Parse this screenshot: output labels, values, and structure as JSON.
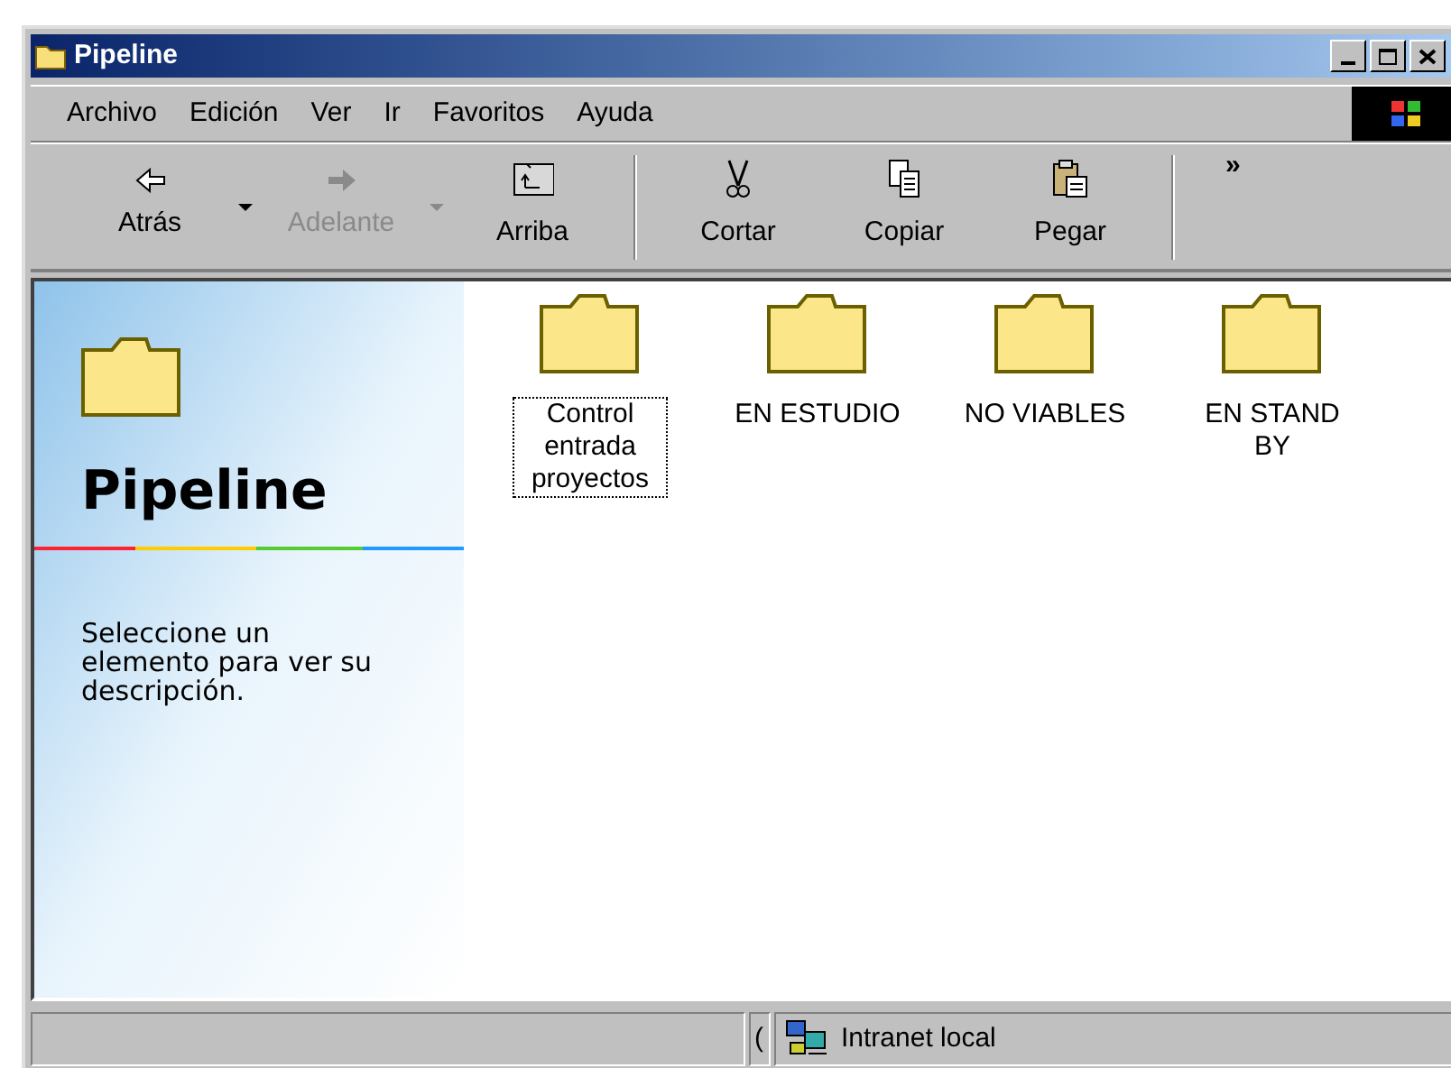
{
  "window": {
    "title": "Pipeline"
  },
  "menu": [
    "Archivo",
    "Edición",
    "Ver",
    "Ir",
    "Favoritos",
    "Ayuda"
  ],
  "toolbar": [
    {
      "kind": "back",
      "label": "Atrás",
      "disabled": false,
      "dropdown": true
    },
    {
      "kind": "forward",
      "label": "Adelante",
      "disabled": true,
      "dropdown": true
    },
    {
      "kind": "up",
      "label": "Arriba",
      "disabled": false,
      "dropdown": false
    },
    {
      "kind": "separator"
    },
    {
      "kind": "cut",
      "label": "Cortar",
      "disabled": false,
      "dropdown": false
    },
    {
      "kind": "copy",
      "label": "Copiar",
      "disabled": false,
      "dropdown": false
    },
    {
      "kind": "paste",
      "label": "Pegar",
      "disabled": false,
      "dropdown": false
    },
    {
      "kind": "separator"
    },
    {
      "kind": "more",
      "label": "»"
    }
  ],
  "panel": {
    "title": "Pipeline",
    "description": "Seleccione un elemento para ver su descripción."
  },
  "folders": [
    {
      "name": "Control entrada proyectos",
      "focused": true
    },
    {
      "name": "EN ESTUDIO",
      "focused": false
    },
    {
      "name": "NO VIABLES",
      "focused": false
    },
    {
      "name": "EN STAND BY",
      "focused": false
    }
  ],
  "status_bar": {
    "count": "(",
    "zone": "Intranet local"
  }
}
